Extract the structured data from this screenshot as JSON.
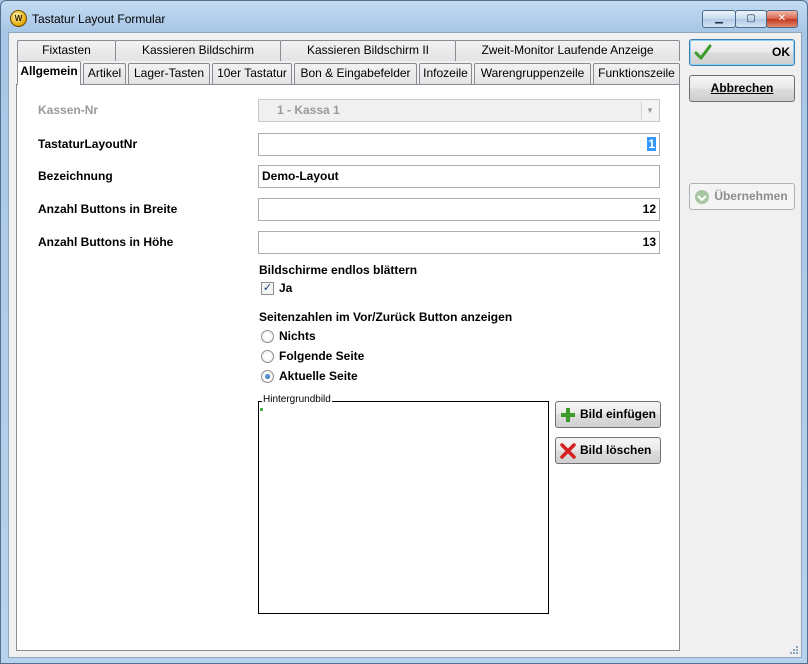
{
  "window": {
    "title": "Tastatur Layout Formular"
  },
  "tabs_row1": [
    "Fixtasten",
    "Kassieren Bildschirm",
    "Kassieren Bildschirm II",
    "Zweit-Monitor Laufende Anzeige"
  ],
  "tabs_row2": [
    "Allgemein",
    "Artikel",
    "Lager-Tasten",
    "10er Tastatur",
    "Bon & Eingabefelder",
    "Infozeile",
    "Warengruppenzeile",
    "Funktionszeile"
  ],
  "active_tab": "Allgemein",
  "buttons": {
    "ok": "OK",
    "cancel": "Abbrechen",
    "apply": "Übernehmen"
  },
  "form": {
    "kassen_nr": {
      "label": "Kassen-Nr",
      "value": "1 - Kassa 1"
    },
    "layout_nr": {
      "label": "TastaturLayoutNr",
      "value": "1"
    },
    "bezeichnung": {
      "label": "Bezeichnung",
      "value": "Demo-Layout"
    },
    "breite": {
      "label": "Anzahl Buttons in Breite",
      "value": "12"
    },
    "hoehe": {
      "label": "Anzahl Buttons in Höhe",
      "value": "13"
    },
    "endlos": {
      "label": "Bildschirme endlos blättern",
      "option": "Ja",
      "checked": true
    },
    "seitenzahlen": {
      "label": "Seitenzahlen im Vor/Zurück Button anzeigen",
      "options": [
        "Nichts",
        "Folgende Seite",
        "Aktuelle Seite"
      ],
      "selected": "Aktuelle Seite"
    },
    "hintergrundbild": {
      "label": "Hintergrundbild",
      "insert": "Bild einfügen",
      "delete": "Bild löschen"
    }
  },
  "colors": {
    "accent_green": "#3a9a2a",
    "delete_red": "#d42020",
    "title_bar": "#b9d2ec"
  }
}
